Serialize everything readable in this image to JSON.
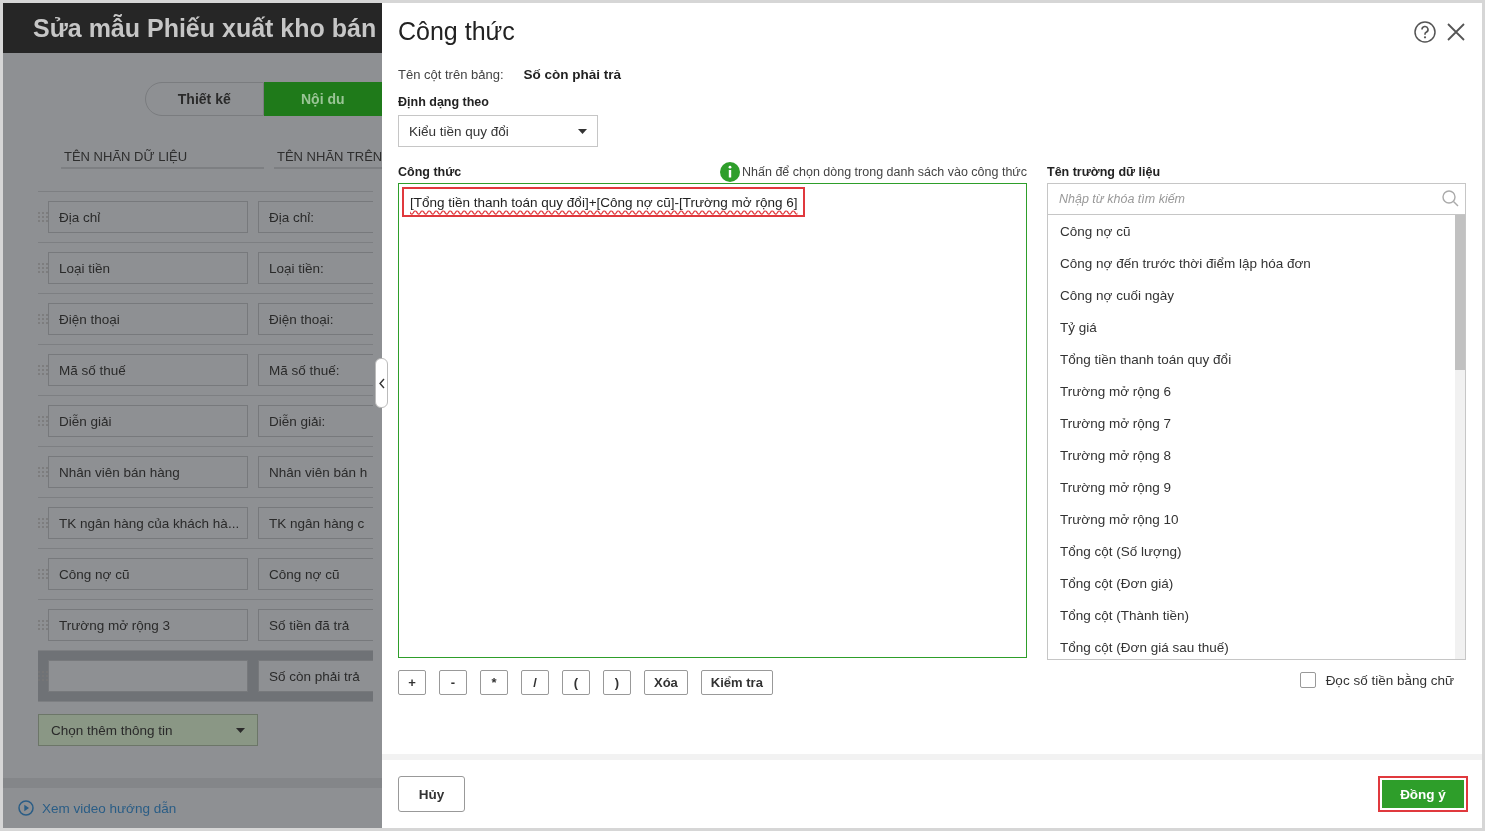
{
  "page": {
    "title": "Sửa mẫu Phiếu xuất kho bán",
    "tabs": [
      {
        "label": "Thiết kế",
        "selected": false
      },
      {
        "label": "Nội du",
        "selected": true
      }
    ],
    "columns": [
      "TÊN NHÃN DỮ LIỆU",
      "TÊN NHÃN TRÊN"
    ],
    "rows": [
      {
        "data_label": "Địa chỉ",
        "print_label": "Địa chỉ:",
        "selected": false
      },
      {
        "data_label": "Loại tiền",
        "print_label": "Loại tiền:",
        "selected": false
      },
      {
        "data_label": "Điện thoại",
        "print_label": "Điện thoại:",
        "selected": false
      },
      {
        "data_label": "Mã số thuế",
        "print_label": "Mã số thuế:",
        "selected": false
      },
      {
        "data_label": "Diễn giải",
        "print_label": "Diễn giải:",
        "selected": false
      },
      {
        "data_label": "Nhân viên bán hàng",
        "print_label": "Nhân viên bán h",
        "selected": false
      },
      {
        "data_label": "TK ngân hàng của khách hà...",
        "print_label": "TK ngân hàng c",
        "selected": false
      },
      {
        "data_label": "Công nợ cũ",
        "print_label": "Công nợ cũ",
        "selected": false
      },
      {
        "data_label": "Trường mở rộng 3",
        "print_label": "Số tiền đã trả",
        "selected": false
      },
      {
        "print_label": "Số còn phải trả",
        "selected": true
      }
    ],
    "add_dropdown": "Chọn thêm thông tin",
    "video_link": "Xem video hướng dẫn"
  },
  "dialog": {
    "title": "Công thức",
    "column_name_label": "Tên cột trên bảng:",
    "column_name": "Số còn phải trả",
    "format_label": "Định dạng theo",
    "format_value": "Kiểu tiền quy đổi",
    "formula_label": "Công thức",
    "hint": "Nhấn để chọn dòng trong danh sách vào công thức",
    "formula": "[Tổng tiền thanh toán quy đổi]+[Công nợ cũ]-[Trường mở rộng 6]",
    "operators": [
      "+",
      "-",
      "*",
      "/",
      "(",
      ")"
    ],
    "clear_button": "Xóa",
    "check_button": "Kiểm tra",
    "fields_label": "Tên trường dữ liệu",
    "search": {
      "placeholder": "Nhập từ khóa tìm kiếm"
    },
    "fields": [
      "Công nợ cũ",
      "Công nợ đến trước thời điểm lập hóa đơn",
      "Công nợ cuối ngày",
      "Tỷ giá",
      "Tổng tiền thanh toán quy đổi",
      "Trường mở rộng 6",
      "Trường mở rộng 7",
      "Trường mở rộng 8",
      "Trường mở rộng 9",
      "Trường mở rộng 10",
      "Tổng cột (Số lượng)",
      "Tổng cột (Đơn giá)",
      "Tổng cột (Thành tiền)",
      "Tổng cột (Đơn giá sau thuế)"
    ],
    "read_amount": {
      "label": "Đọc số tiền bằng chữ",
      "checked": false
    },
    "cancel_button": "Hủy",
    "ok_button": "Đồng ý"
  }
}
